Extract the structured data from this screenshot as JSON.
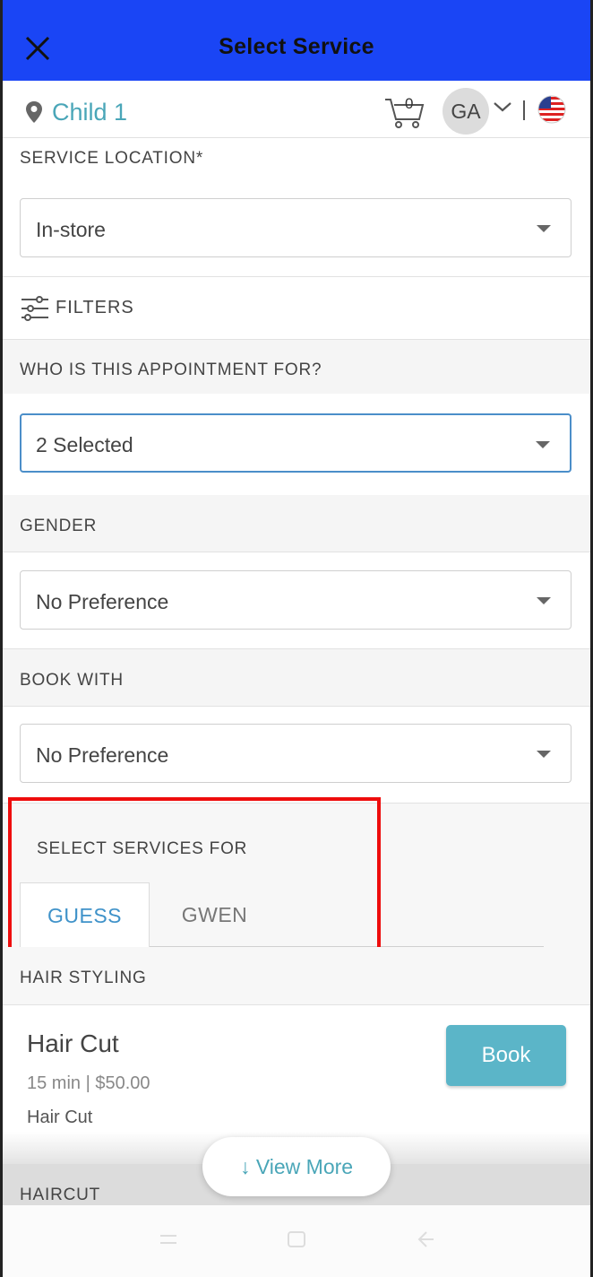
{
  "header": {
    "title": "Select Service",
    "close_icon": "close-icon"
  },
  "subheader": {
    "location_icon": "map-pin-icon",
    "location": "Child 1",
    "cart_icon": "cart-icon",
    "cart_count": "0",
    "avatar_initials": "GA",
    "dropdown_icon": "chevron-down-icon",
    "separator": "|",
    "flag_icon": "us-flag-icon"
  },
  "service_location": {
    "label": "SERVICE LOCATION*",
    "value": "In-store"
  },
  "filters": {
    "icon": "sliders-icon",
    "label": "FILTERS"
  },
  "appointment_for": {
    "label": "WHO IS THIS APPOINTMENT FOR?",
    "value": "2 Selected"
  },
  "gender": {
    "label": "GENDER",
    "value": "No Preference"
  },
  "book_with": {
    "label": "BOOK WITH",
    "value": "No Preference"
  },
  "select_services": {
    "label": "SELECT SERVICES FOR",
    "tabs": [
      {
        "label": "GUESS",
        "active": true
      },
      {
        "label": "GWEN",
        "active": false
      }
    ]
  },
  "categories": [
    {
      "title": "HAIR STYLING",
      "services": [
        {
          "name": "Hair Cut",
          "meta": "15 min | $50.00",
          "description": "Hair Cut",
          "button": "Book"
        }
      ]
    },
    {
      "title": "HAIRCUT",
      "services": []
    }
  ],
  "view_more": "↓ View More",
  "colors": {
    "header_bg": "#1a45f5",
    "accent": "#4aa6b8",
    "book_button": "#5bb5c8",
    "highlight": "#ee0d0d",
    "tab_active": "#3f92c9"
  }
}
